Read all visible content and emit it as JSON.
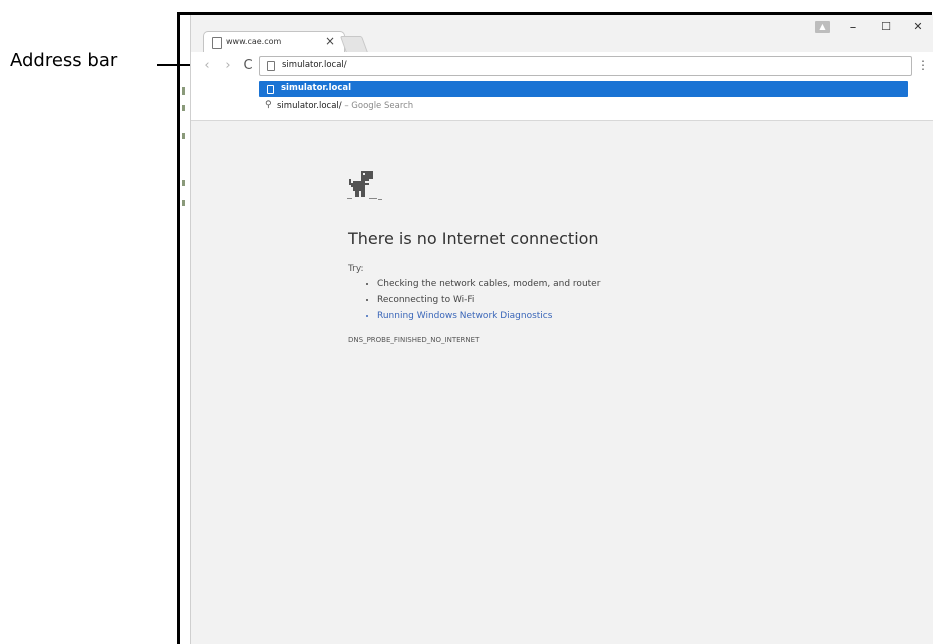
{
  "callout": {
    "label": "Address bar"
  },
  "browser": {
    "tab": {
      "title": "www.cae.com",
      "close": "×"
    },
    "window_controls": {
      "minimize": "–",
      "maximize": "☐",
      "close": "✕"
    },
    "toolbar": {
      "back": "‹",
      "forward": "›",
      "reload": "C",
      "menu": "⋮"
    },
    "omnibox": {
      "value": "simulator.local/"
    },
    "suggestions": [
      {
        "text": "simulator.local",
        "type": "url",
        "selected": true
      },
      {
        "text": "simulator.local/",
        "suffix": " – Google Search",
        "type": "search",
        "selected": false
      }
    ]
  },
  "error_page": {
    "heading": "There is no Internet connection",
    "try_label": "Try:",
    "tips": [
      "Checking the network cables, modem, and router",
      "Reconnecting to Wi-Fi",
      "Running Windows Network Diagnostics"
    ],
    "error_code": "DNS_PROBE_FINISHED_NO_INTERNET"
  },
  "colors": {
    "highlight": "#1a73d4",
    "link": "#3a66b8",
    "page_bg": "#f2f2f2"
  }
}
